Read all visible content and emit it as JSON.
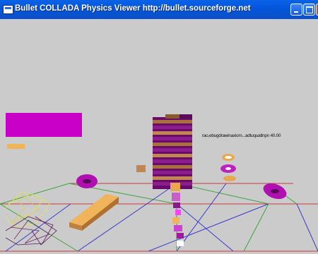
{
  "window": {
    "title": "Bullet COLLADA Physics Viewer http://bullet.sourceforge.net",
    "icon": "app-window-icon",
    "buttons": [
      "minimize-icon",
      "maximize-icon",
      "close-icon"
    ]
  },
  "viewport": {
    "background_color": "#cbcbcb",
    "hud_text": "rao,ebugdrawinaxiom...adtuquatlnpn"
  },
  "hud_value": "40.00"
}
